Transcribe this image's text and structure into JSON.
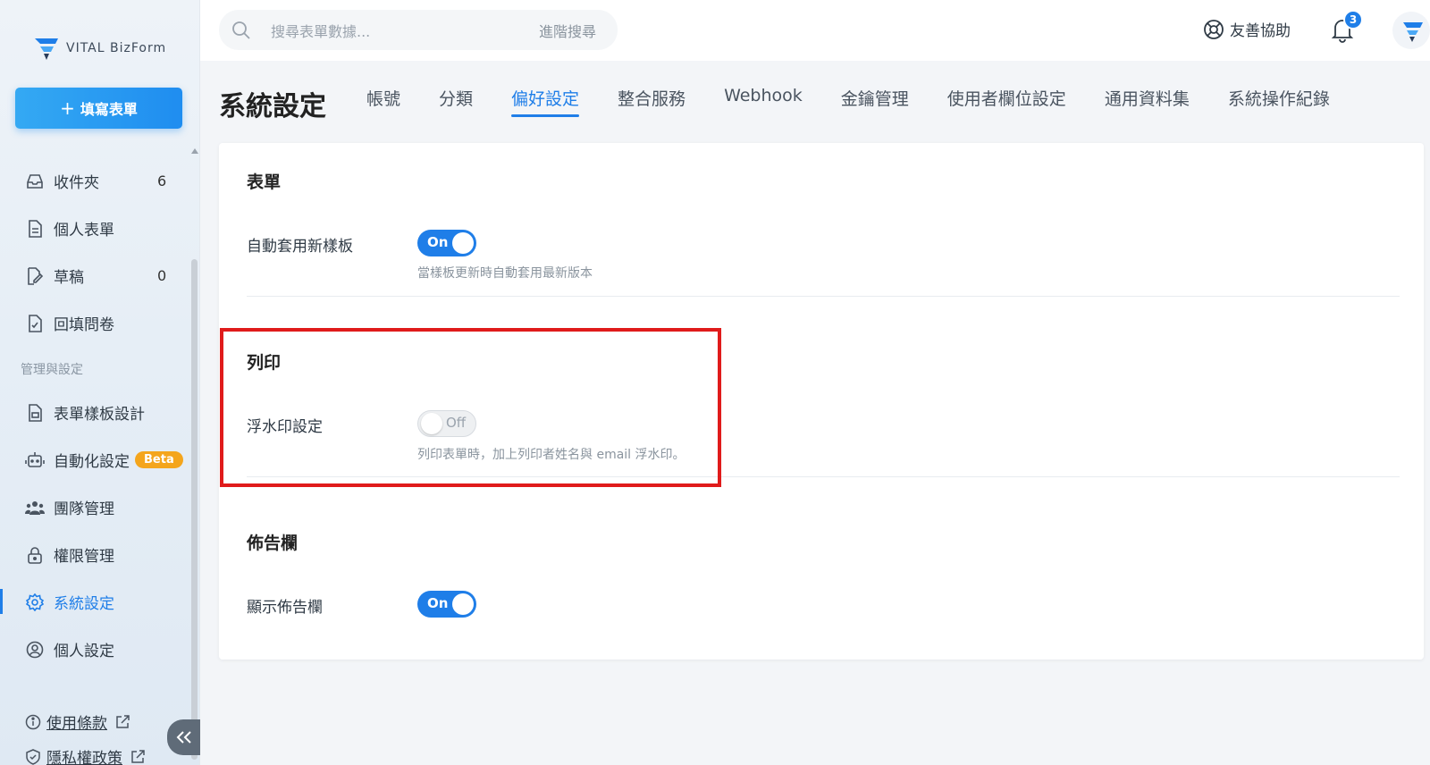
{
  "sidebar": {
    "logo_text": "VITAL BizForm",
    "fill_button": "填寫表單",
    "items": [
      {
        "label": "收件夾",
        "count": "6",
        "icon": "inbox-icon"
      },
      {
        "label": "個人表單",
        "count": "",
        "icon": "document-icon"
      },
      {
        "label": "草稿",
        "count": "0",
        "icon": "draft-edit-icon"
      },
      {
        "label": "回填問卷",
        "count": "",
        "icon": "checklist-doc-icon"
      }
    ],
    "section_label": "管理與設定",
    "admin_items": [
      {
        "label": "表單樣板設計",
        "icon": "template-doc-icon"
      },
      {
        "label": "自動化設定",
        "badge": "Beta",
        "icon": "robot-icon"
      },
      {
        "label": "團隊管理",
        "icon": "team-icon"
      },
      {
        "label": "權限管理",
        "icon": "lock-icon"
      },
      {
        "label": "系統設定",
        "icon": "gear-icon",
        "active": true
      },
      {
        "label": "個人設定",
        "icon": "user-circle-icon"
      }
    ],
    "footer": [
      {
        "label": "使用條款",
        "icon": "info-icon"
      },
      {
        "label": "隱私權政策",
        "icon": "shield-icon"
      }
    ]
  },
  "topbar": {
    "search_placeholder": "搜尋表單數據...",
    "advanced_search": "進階搜尋",
    "help_label": "友善協助",
    "notification_count": "3"
  },
  "page": {
    "title": "系統設定",
    "tabs": [
      "帳號",
      "分類",
      "偏好設定",
      "整合服務",
      "Webhook",
      "金鑰管理",
      "使用者欄位設定",
      "通用資料集",
      "系統操作紀錄"
    ],
    "active_tab": "偏好設定"
  },
  "settings": {
    "form": {
      "title": "表單",
      "auto_template_label": "自動套用新樣板",
      "auto_template_state": "On",
      "auto_template_desc": "當樣板更新時自動套用最新版本"
    },
    "print": {
      "title": "列印",
      "watermark_label": "浮水印設定",
      "watermark_state": "Off",
      "watermark_desc": "列印表單時，加上列印者姓名與 email 浮水印。"
    },
    "bulletin": {
      "title": "佈告欄",
      "show_label": "顯示佈告欄",
      "show_state": "On"
    }
  },
  "colors": {
    "accent": "#1f7ee8",
    "highlight": "#e01b1b",
    "beta": "#f4a51c"
  }
}
